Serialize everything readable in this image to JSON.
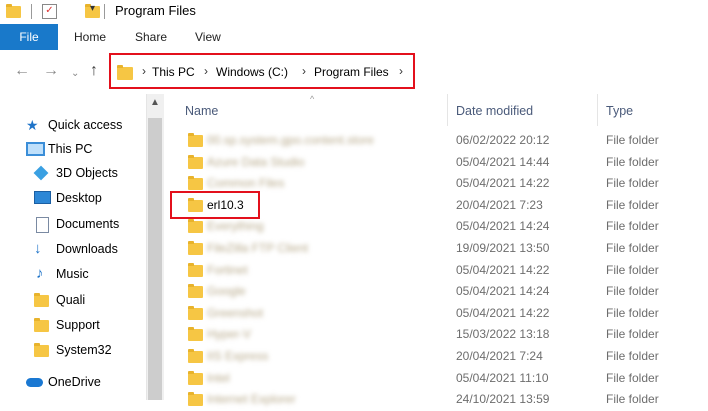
{
  "window": {
    "title": "Program Files"
  },
  "ribbon": {
    "tabs": [
      "File",
      "Home",
      "Share",
      "View"
    ]
  },
  "address": {
    "crumbs": [
      "This PC",
      "Windows (C:)",
      "Program Files"
    ]
  },
  "nav": {
    "items": [
      {
        "label": "Quick access",
        "icon": "star-icon"
      },
      {
        "label": "This PC",
        "icon": "computer-icon"
      },
      {
        "label": "3D Objects",
        "icon": "3d-objects-icon"
      },
      {
        "label": "Desktop",
        "icon": "desktop-icon"
      },
      {
        "label": "Documents",
        "icon": "documents-icon"
      },
      {
        "label": "Downloads",
        "icon": "download-arrow-icon"
      },
      {
        "label": "Music",
        "icon": "music-note-icon"
      },
      {
        "label": "Quali",
        "icon": "folder-icon"
      },
      {
        "label": "Support",
        "icon": "folder-icon"
      },
      {
        "label": "System32",
        "icon": "folder-icon"
      },
      {
        "label": "OneDrive",
        "icon": "cloud-icon"
      }
    ]
  },
  "columns": {
    "name": "Name",
    "date": "Date modified",
    "type": "Type"
  },
  "files": [
    {
      "name": "00.sp.system.gpo.content.store",
      "date": "06/02/2022 20:12",
      "type": "File folder",
      "blurred": true
    },
    {
      "name": "Azure Data Studio",
      "date": "05/04/2021 14:44",
      "type": "File folder",
      "blurred": true
    },
    {
      "name": "Common Files",
      "date": "05/04/2021 14:22",
      "type": "File folder",
      "blurred": true
    },
    {
      "name": "erl10.3",
      "date": "20/04/2021 7:23",
      "type": "File folder",
      "blurred": false
    },
    {
      "name": "Everything",
      "date": "05/04/2021 14:24",
      "type": "File folder",
      "blurred": true
    },
    {
      "name": "FileZilla FTP Client",
      "date": "19/09/2021 13:50",
      "type": "File folder",
      "blurred": true
    },
    {
      "name": "Fortinet",
      "date": "05/04/2021 14:22",
      "type": "File folder",
      "blurred": true
    },
    {
      "name": "Google",
      "date": "05/04/2021 14:24",
      "type": "File folder",
      "blurred": true
    },
    {
      "name": "Greenshot",
      "date": "05/04/2021 14:22",
      "type": "File folder",
      "blurred": true
    },
    {
      "name": "Hyper-V",
      "date": "15/03/2022 13:18",
      "type": "File folder",
      "blurred": true
    },
    {
      "name": "IIS Express",
      "date": "20/04/2021 7:24",
      "type": "File folder",
      "blurred": true
    },
    {
      "name": "Intel",
      "date": "05/04/2021 11:10",
      "type": "File folder",
      "blurred": true
    },
    {
      "name": "Internet Explorer",
      "date": "24/10/2021 13:59",
      "type": "File folder",
      "blurred": true
    }
  ],
  "colors": {
    "accent": "#1979ca",
    "highlight": "#e3101c",
    "folder": "#f6c644"
  }
}
